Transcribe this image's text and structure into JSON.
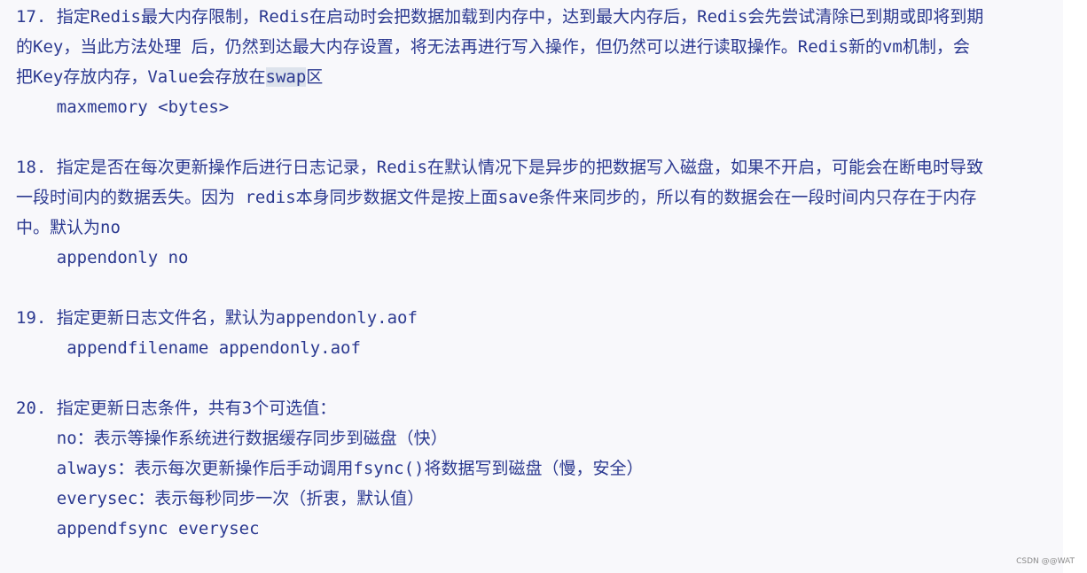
{
  "document": {
    "lines": [
      "17. 指定Redis最大内存限制，Redis在启动时会把数据加载到内存中，达到最大内存后，Redis会先尝试清除已到期或即将到期",
      "的Key，当此方法处理 后，仍然到达最大内存设置，将无法再进行写入操作，但仍然可以进行读取操作。Redis新的vm机制，会",
      "把Key存放内存，Value会存放在",
      "    maxmemory <bytes>",
      "",
      "18. 指定是否在每次更新操作后进行日志记录，Redis在默认情况下是异步的把数据写入磁盘，如果不开启，可能会在断电时导致",
      "一段时间内的数据丢失。因为 redis本身同步数据文件是按上面save条件来同步的，所以有的数据会在一段时间内只存在于内存",
      "中。默认为no",
      "    appendonly no",
      "",
      "19. 指定更新日志文件名，默认为appendonly.aof",
      "     appendfilename appendonly.aof",
      "",
      "20. 指定更新日志条件，共有3个可选值：",
      "    no：表示等操作系统进行数据缓存同步到磁盘（快）",
      "    always：表示每次更新操作后手动调用fsync()将数据写到磁盘（慢，安全）",
      "    everysec：表示每秒同步一次（折衷，默认值）",
      "    appendfsync everysec"
    ],
    "line3_highlight": "swap",
    "line3_tail": "区"
  },
  "watermark": "CSDN @@WAT",
  "colors": {
    "text": "#2b3990",
    "panel_bg": "#f8f8fb",
    "highlight_bg": "#dde3ec"
  }
}
